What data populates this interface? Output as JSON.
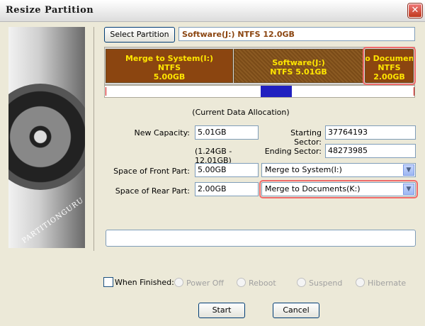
{
  "window": {
    "title": "Resize Partition"
  },
  "select_partition_label": "Select Partition",
  "selected_partition": "Software(J:) NTFS 12.0GB",
  "side_brand": "PARTITIONGURU",
  "partitions": [
    {
      "line1": "Merge to System(I:)",
      "line2": "NTFS",
      "line3": "5.00GB"
    },
    {
      "line1": "Software(J:)",
      "line2": "NTFS 5.01GB"
    },
    {
      "line1": "to Documents",
      "line2": "NTFS",
      "line3": "2.00GB"
    }
  ],
  "allocation_caption": "(Current Data Allocation)",
  "new_capacity": {
    "label": "New Capacity:",
    "value": "5.01GB",
    "range": "(1.24GB - 12.01GB)"
  },
  "starting_sector": {
    "label": "Starting Sector:",
    "value": "37764193"
  },
  "ending_sector": {
    "label": "Ending Sector:",
    "value": "48273985"
  },
  "front_part": {
    "label": "Space of Front Part:",
    "value": "5.00GB",
    "combo": "Merge to System(I:)"
  },
  "rear_part": {
    "label": "Space of Rear Part:",
    "value": "2.00GB",
    "combo": "Merge to Documents(K:)"
  },
  "when_finished": {
    "label": "When Finished:",
    "options": [
      "Power Off",
      "Reboot",
      "Suspend",
      "Hibernate"
    ]
  },
  "buttons": {
    "start": "Start",
    "cancel": "Cancel"
  },
  "colors": {
    "partition": "#8b4510",
    "highlight": "#f06a6a",
    "text_yellow": "#ffe600"
  }
}
